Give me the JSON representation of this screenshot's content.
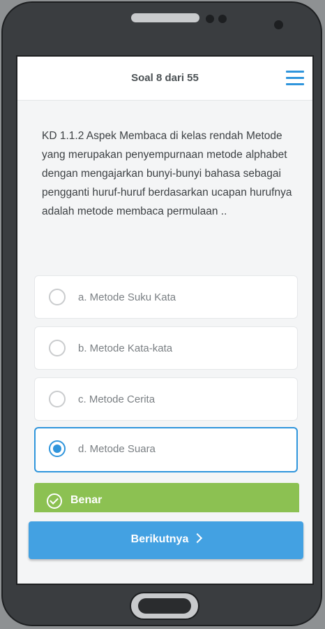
{
  "header": {
    "title": "Soal 8 dari 55",
    "menu_icon": "hamburger-menu-icon"
  },
  "question": {
    "text": "KD 1.1.2 Aspek Membaca di kelas rendah Metode yang merupakan penyempurnaan metode alphabet dengan mengajarkan bunyi-bunyi bahasa sebagai pengganti huruf-huruf berdasarkan ucapan hurufnya adalah metode membaca permulaan .."
  },
  "options": [
    {
      "label": "a. Metode Suku Kata",
      "selected": false
    },
    {
      "label": "b. Metode Kata-kata",
      "selected": false
    },
    {
      "label": "c. Metode Cerita",
      "selected": false
    },
    {
      "label": "d. Metode Suara",
      "selected": true
    }
  ],
  "result": {
    "label": "Benar",
    "icon": "check-circle-icon",
    "color": "#8cc152"
  },
  "footer": {
    "next_label": "Berikutnya",
    "icon": "chevron-right-icon",
    "color": "#43a1e2"
  },
  "colors": {
    "accent": "#2f95dc"
  }
}
